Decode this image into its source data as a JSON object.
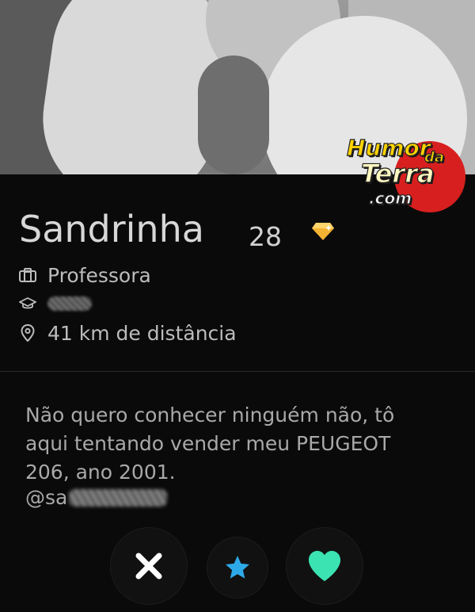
{
  "profile": {
    "name": "Sandrinha",
    "age": "28",
    "job": "Professora",
    "school": "",
    "distance": "41 km de distância",
    "bio_lines": [
      "Não quero conhecer ninguém não, tô",
      "aqui tentando vender meu PEUGEOT",
      "206, ano 2001."
    ],
    "handle_prefix": "@sa"
  },
  "watermark": {
    "line1": "Humor",
    "line2": "da",
    "line3": "Terra",
    "line4": ".com"
  },
  "icons": {
    "badge": "diamond-badge-icon",
    "job": "briefcase-icon",
    "school": "graduation-cap-icon",
    "distance": "location-pin-icon",
    "nope": "close-icon",
    "super_like": "star-icon",
    "like": "heart-icon"
  },
  "colors": {
    "background": "#0a0a0a",
    "badge": "#f5b333",
    "nope": "#ffffff",
    "super_like": "#2ea9e8",
    "like": "#3be3b3",
    "watermark_sun": "#d81f1f"
  }
}
